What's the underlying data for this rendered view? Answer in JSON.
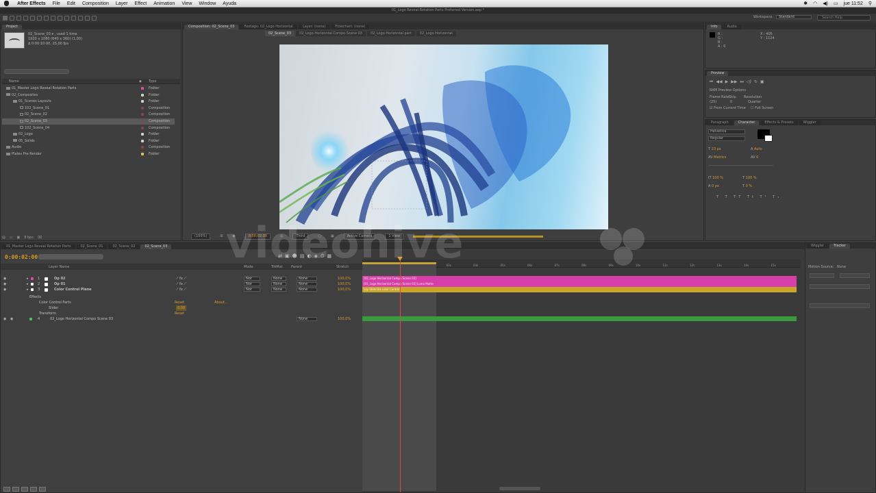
{
  "menubar": {
    "app": "After Effects",
    "items": [
      "File",
      "Edit",
      "Composition",
      "Layer",
      "Effect",
      "Animation",
      "View",
      "Window",
      "Ayuda"
    ],
    "clock": "jue 11:52"
  },
  "window_title": "01_Logo Reveal Rotation Parts Preferred Version.aep *",
  "toolbar": {
    "workspace_label": "Workspace:",
    "workspace_value": "Standard",
    "search_placeholder": "Search Help"
  },
  "project": {
    "tab": "Project",
    "selected_name": "02_Scene_03 ▾ , used 1 time",
    "info_line1": "1920 x 1080 (640 x 360) (1,00)",
    "info_line2": "Δ 0:00:10:00, 25,00 fps",
    "col_name": "Name",
    "col_type": "Type",
    "rows": [
      {
        "indent": 0,
        "icon": "folder",
        "name": "01_Master Logo Reveal Rotation Parts",
        "type": "Folder",
        "label_color": "#e04aa0",
        "selected": false
      },
      {
        "indent": 0,
        "icon": "folder",
        "name": "02_Composites",
        "type": "Folder",
        "label_color": "#d0d0d0",
        "selected": false
      },
      {
        "indent": 1,
        "icon": "folder",
        "name": "01_Scenes Layouts",
        "type": "Folder",
        "label_color": "#d0d0d0",
        "selected": false
      },
      {
        "indent": 2,
        "icon": "comp",
        "name": "102_Scene_01",
        "type": "Composition",
        "label_color": "#7a4a4a",
        "selected": false
      },
      {
        "indent": 2,
        "icon": "comp",
        "name": "02_Scene_02",
        "type": "Composition",
        "label_color": "#7a4a4a",
        "selected": false
      },
      {
        "indent": 2,
        "icon": "comp",
        "name": "02_Scene_03",
        "type": "Composition",
        "label_color": "#7a4a4a",
        "selected": true
      },
      {
        "indent": 2,
        "icon": "comp",
        "name": "102_Scene_04",
        "type": "Composition",
        "label_color": "#7a4a4a",
        "selected": false
      },
      {
        "indent": 1,
        "icon": "folder",
        "name": "02_Logo",
        "type": "Folder",
        "label_color": "#d0d0d0",
        "selected": false
      },
      {
        "indent": 1,
        "icon": "folder",
        "name": "05_Solids",
        "type": "Folder",
        "label_color": "#d0d0d0",
        "selected": false
      },
      {
        "indent": 0,
        "icon": "folder",
        "name": "Audio",
        "type": "Composition",
        "label_color": "#7a4a4a",
        "selected": false
      },
      {
        "indent": 0,
        "icon": "folder",
        "name": "Plates Pre Render",
        "type": "Folder",
        "label_color": "#d8c84a",
        "selected": false
      }
    ],
    "bpc": "8 bpc"
  },
  "composition": {
    "tabs": [
      "Composition: 02_Scene_03",
      "Footage: 02_Logo Horizontal",
      "Layer: (none)",
      "Flowchart: (none)"
    ],
    "subtabs": [
      "02_Scene_03",
      "02_Logo Horizontal Compo Scene 03",
      "02_Logo Horizontal part",
      "02_Logo Horizontal"
    ],
    "zoom": "(100%)",
    "timecode": "0:00:02:00",
    "resolution": "Third",
    "camera": "Active Camera",
    "view": "1 View"
  },
  "info": {
    "tab1": "Info",
    "tab2": "Audio",
    "r": "R :",
    "g": "G :",
    "b": "B :",
    "a": "A : 0",
    "x": "X : 405",
    "y": "Y : 1124"
  },
  "preview": {
    "tab": "Preview",
    "ram_options": "RAM Preview Options",
    "frame_rate_label": "Frame Rate",
    "skip_label": "Skip",
    "resolution_label": "Resolution",
    "frame_rate": "(25)",
    "skip": "0",
    "resolution": "Quarter",
    "from_current": "From Current Time",
    "full_screen": "Full Screen"
  },
  "character": {
    "tabs": [
      "Paragraph",
      "Character",
      "Effects & Presets",
      "Wiggler"
    ],
    "font": "Helvetica",
    "style": "Regular",
    "size": "23 px",
    "leading": "Auto",
    "tracking": "0",
    "kerning": "Metrics",
    "scale_v": "100 %",
    "scale_h": "100 %",
    "baseline": "0 px",
    "tsume": "0 %"
  },
  "timeline": {
    "tabs": [
      "01_Master Logo Reveal Rotation Parts",
      "02_Scene_01",
      "02_Scene_02",
      "02_Scene_03"
    ],
    "timecode": "0:00:02:00",
    "col_layer_name": "Layer Name",
    "col_mode": "Mode",
    "col_trkmat": "TrkMat",
    "col_parent": "Parent",
    "col_stretch": "Stretch",
    "layers": [
      {
        "num": "1",
        "name": "Op 02",
        "swatch": "#e04aa0",
        "mode": "Nor",
        "trkmat": "None",
        "parent": "None",
        "stretch": "100,0%"
      },
      {
        "num": "2",
        "name": "Op 01",
        "swatch": "#ffffff",
        "mode": "Nor",
        "trkmat": "None",
        "parent": "None",
        "stretch": "100,0%"
      },
      {
        "num": "3",
        "name": "Color Control Plane",
        "swatch": "#ffffff",
        "mode": "Nor",
        "trkmat": "None",
        "parent": "None",
        "stretch": "100,0%"
      }
    ],
    "effects_label": "Effects",
    "color_control_label": "Color Control Parts",
    "reset_label": "Reset",
    "about_label": "About...",
    "slider_label": "Slider",
    "slider_value": "0,00",
    "transform_label": "Transform",
    "transform_reset": "Reset",
    "layer4": {
      "num": "4",
      "name": "02_Logo Horizontal Compo Scene 03",
      "parent": "None",
      "stretch": "100,0%"
    },
    "bar_labels": [
      "[02_Logo Horizontal Compo Scene 03]",
      "[01_Logo Horizontal Compo Scene 03] Luma Matte",
      "Lay Slide Dis color Control"
    ],
    "ruler_ticks": [
      "00s",
      "01s",
      "02s",
      "03s",
      "04s",
      "05s",
      "06s",
      "07s",
      "08s",
      "09s",
      "10s",
      "11s",
      "12s",
      "13s",
      "14s",
      "15s"
    ]
  },
  "tracker": {
    "tab1": "Wiggler",
    "tab2": "Tracker",
    "motion_source_label": "Motion Source:",
    "motion_source": "None"
  },
  "watermark": "videohive"
}
